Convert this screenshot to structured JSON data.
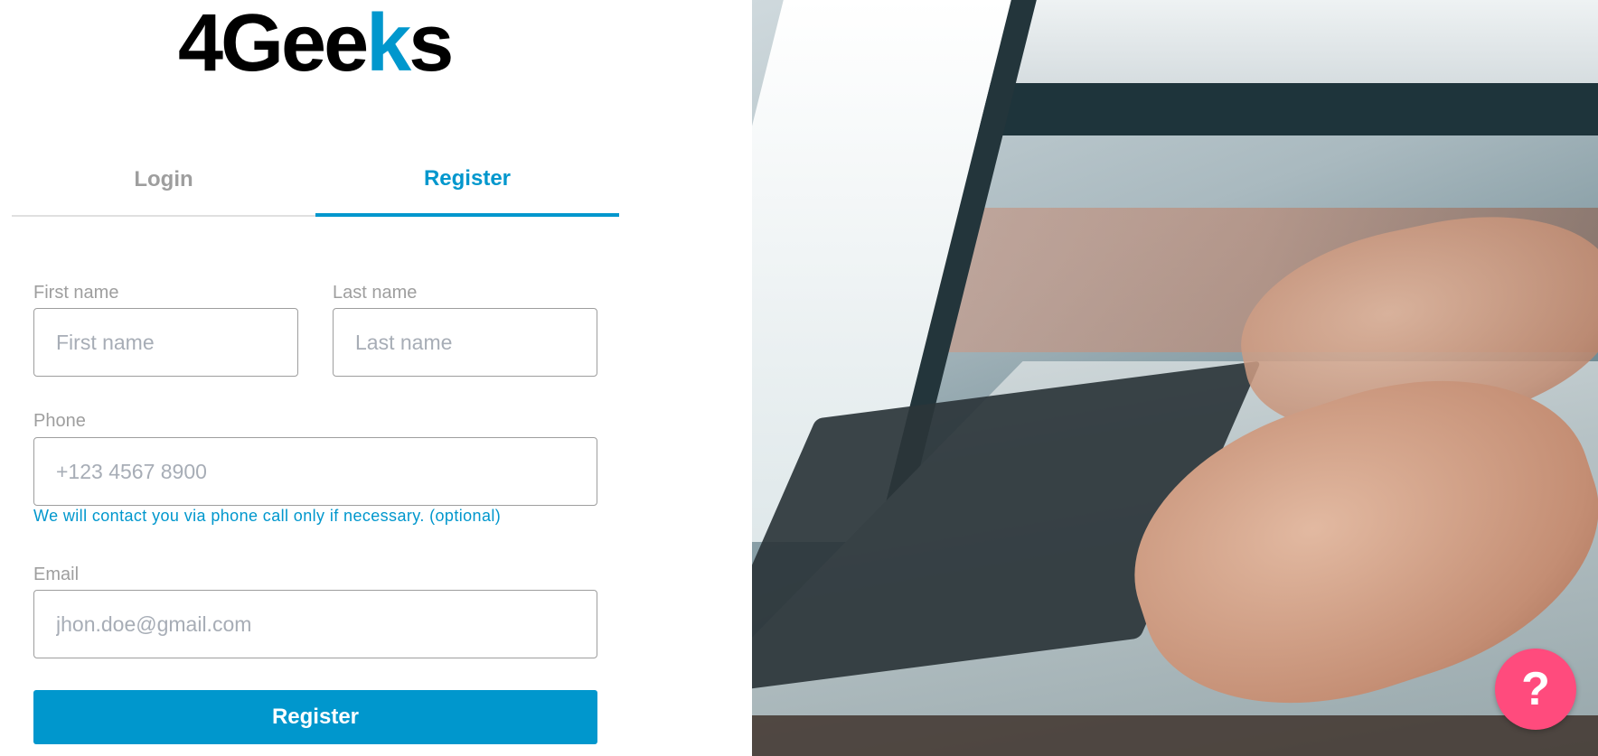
{
  "logo": {
    "text_main": "4Gee",
    "text_accent": "k",
    "text_end": "s"
  },
  "tabs": [
    {
      "label": "Login",
      "active": false
    },
    {
      "label": "Register",
      "active": true
    }
  ],
  "form": {
    "first_name": {
      "label": "First name",
      "placeholder": "First name",
      "value": ""
    },
    "last_name": {
      "label": "Last name",
      "placeholder": "Last name",
      "value": ""
    },
    "phone": {
      "label": "Phone",
      "placeholder": "+123 4567 8900",
      "value": "",
      "helper": "We will contact you via phone call only if necessary. (optional)"
    },
    "email": {
      "label": "Email",
      "placeholder": "jhon.doe@gmail.com",
      "value": ""
    },
    "submit_label": "Register"
  },
  "help_button": {
    "label": "?",
    "icon": "question-mark-icon"
  },
  "colors": {
    "accent": "#0097cd",
    "help": "#ff4b7d",
    "muted": "#9e9e9e"
  }
}
